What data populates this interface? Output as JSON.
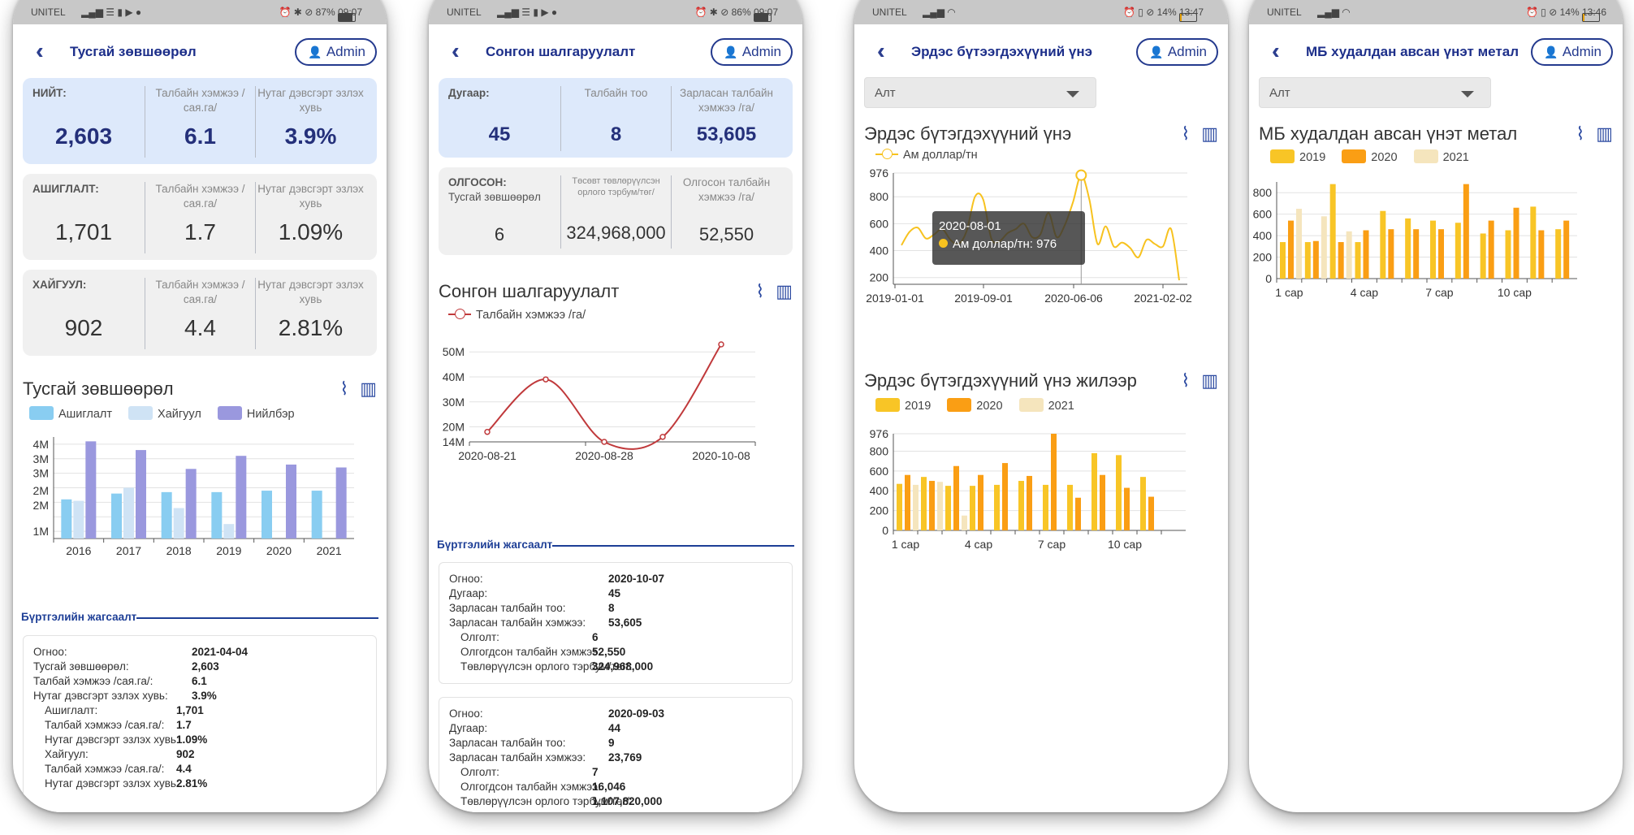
{
  "phones": [
    {
      "status": {
        "carrier": "UNITEL",
        "battery": "87%",
        "time": "09:07"
      },
      "header": {
        "title": "Тусгай зөвшөөрөл",
        "admin": "Admin"
      },
      "cards": [
        {
          "label": "НИЙТ:",
          "v1": "2,603",
          "l2": "Талбайн хэмжээ /сая.га/",
          "v2": "6.1",
          "l3": "Нутаг дэвсгэрт эзлэх хувь",
          "v3": "3.9%"
        },
        {
          "label": "АШИГЛАЛТ:",
          "v1": "1,701",
          "l2": "Талбайн хэмжээ /сая.га/",
          "v2": "1.7",
          "l3": "Нутаг дэвсгэрт эзлэх хувь",
          "v3": "1.09%"
        },
        {
          "label": "ХАЙГУУЛ:",
          "v1": "902",
          "l2": "Талбайн хэмжээ /сая.га/",
          "v2": "4.4",
          "l3": "Нутаг дэвсгэрт эзлэх хувь",
          "v3": "2.81%"
        }
      ],
      "section_title": "Тусгай зөвшөөрөл",
      "reg_title": "Бүртгэлийн жагсаалт",
      "reg": [
        {
          "rows": [
            {
              "l": "Огноо:",
              "v": "2021-04-04",
              "i": 0
            },
            {
              "l": "Тусгай зөвшөөрөл:",
              "v": "2,603",
              "i": 0
            },
            {
              "l": "Талбай хэмжээ /сая.га/:",
              "v": "6.1",
              "i": 0
            },
            {
              "l": "Нутаг дэвсгэрт эзлэх хувь:",
              "v": "3.9%",
              "i": 0
            },
            {
              "l": "Ашиглалт:",
              "v": "1,701",
              "i": 1
            },
            {
              "l": "Талбай хэмжээ /сая.га/:",
              "v": "1.7",
              "i": 1
            },
            {
              "l": "Нутаг дэвсгэрт эзлэх хувь:",
              "v": "1.09%",
              "i": 1
            },
            {
              "l": "Хайгуул:",
              "v": "902",
              "i": 1
            },
            {
              "l": "Талбай хэмжээ /сая.га/:",
              "v": "4.4",
              "i": 1
            },
            {
              "l": "Нутаг дэвсгэрт эзлэх хувь:",
              "v": "2.81%",
              "i": 1
            }
          ]
        }
      ]
    },
    {
      "status": {
        "carrier": "UNITEL",
        "battery": "86%",
        "time": "09:07"
      },
      "header": {
        "title": "Сонгон шалгаруулалт",
        "admin": "Admin"
      },
      "cards": [
        {
          "label": "Дугаар:",
          "v1": "45",
          "l2": "Талбайн тоо",
          "v2": "8",
          "l3": "Зарласан талбайн хэмжээ /га/",
          "v3": "53,605"
        },
        {
          "label": "ОЛГОСОН:",
          "sub": "Тусгай зөвшөөрөл",
          "v1": "6",
          "l2": "Төсөвт төвлөрүүлсэн орлого тэрбум/төг/",
          "v2": "324,968,000",
          "l3": "Олгосон талбайн хэмжээ /га/",
          "v3": "52,550"
        }
      ],
      "section_title": "Сонгон шалгаруулалт",
      "reg_title": "Бүртгэлийн жагсаалт",
      "reg": [
        {
          "rows": [
            {
              "l": "Огноо:",
              "v": "2020-10-07",
              "i": 0
            },
            {
              "l": "Дугаар:",
              "v": "45",
              "i": 0
            },
            {
              "l": "Зарласан талбайн тоо:",
              "v": "8",
              "i": 0
            },
            {
              "l": "Зарласан талбайн хэмжээ:",
              "v": "53,605",
              "i": 0
            },
            {
              "l": "Олголт:",
              "v": "6",
              "i": 1
            },
            {
              "l": "Олгогдсон талбайн хэмжээ:",
              "v": "52,550",
              "i": 1
            },
            {
              "l": "Төвлөрүүлсэн орлого тэрбум/төг/:",
              "v": "324,968,000",
              "i": 1
            }
          ]
        },
        {
          "rows": [
            {
              "l": "Огноо:",
              "v": "2020-09-03",
              "i": 0
            },
            {
              "l": "Дугаар:",
              "v": "44",
              "i": 0
            },
            {
              "l": "Зарласан талбайн тоо:",
              "v": "9",
              "i": 0
            },
            {
              "l": "Зарласан талбайн хэмжээ:",
              "v": "23,769",
              "i": 0
            },
            {
              "l": "Олголт:",
              "v": "7",
              "i": 1
            },
            {
              "l": "Олгогдсон талбайн хэмжээ:",
              "v": "16,046",
              "i": 1
            },
            {
              "l": "Төвлөрүүлсэн орлого тэрбум/төг/:",
              "v": "1,107,820,000",
              "i": 1
            }
          ]
        }
      ]
    },
    {
      "status": {
        "carrier": "UNITEL",
        "battery": "14%",
        "time": "13:47"
      },
      "header": {
        "title": "Эрдэс бүтээгдэхүүний үнэ",
        "admin": "Admin"
      },
      "dropdown": "Алт",
      "section_title": "Эрдэс бүтэгдэхүүний үнэ",
      "section2_title": "Эрдэс бүтэгдэхүүний үнэ жилээр",
      "tooltip": {
        "date": "2020-08-01",
        "text": "Ам доллар/тн: 976"
      }
    },
    {
      "status": {
        "carrier": "UNITEL",
        "battery": "14%",
        "time": "13:46"
      },
      "header": {
        "title": "МБ худалдан авсан үнэт метал",
        "admin": "Admin"
      },
      "dropdown": "Алт",
      "section_title": "МБ худалдан авсан үнэт метал"
    }
  ],
  "icons": {
    "back": "double-chevron-left-icon",
    "user": "user-icon",
    "line": "line-chart-icon",
    "bar": "bar-chart-icon"
  },
  "colors": {
    "accent": "#243a8e",
    "ashiglalt": "#89cdf1",
    "haiguul": "#cfe3f5",
    "niilber": "#9a98de",
    "line2": "#c0393b",
    "gold": "#f7c21f",
    "y2019": "#f8c526",
    "y2020": "#fa9e14",
    "y2021": "#f5e5bd"
  },
  "chart_data": [
    {
      "type": "bar",
      "categories": [
        "2016",
        "2017",
        "2018",
        "2019",
        "2020",
        "2021"
      ],
      "series": [
        {
          "name": "Ашиглалт",
          "values": [
            2.1,
            2.3,
            2.35,
            2.35,
            2.4,
            2.4
          ]
        },
        {
          "name": "Хайгуул",
          "values": [
            2.05,
            2.5,
            1.8,
            1.25,
            0.75,
            0.6
          ]
        },
        {
          "name": "Нийлбэр",
          "values": [
            4.1,
            3.8,
            3.15,
            3.6,
            3.3,
            3.2
          ]
        }
      ],
      "ytick_labels": [
        "1M",
        "2M",
        "2M",
        "3M",
        "3M",
        "4M"
      ],
      "ylim": [
        0.75,
        4.25
      ]
    },
    {
      "type": "line",
      "series": [
        {
          "name": "Талбайн хэмжээ /га/",
          "x": [
            "2020-08-21",
            "2020-09-03",
            "2020-09-13",
            "2020-09-24",
            "2020-10-07"
          ],
          "values": [
            18,
            39,
            14,
            16,
            53
          ]
        }
      ],
      "xtick_labels": [
        "2020-08-21",
        "2020-08-28",
        "2020-10-08"
      ],
      "ytick_labels": [
        "14M",
        "20M",
        "30M",
        "40M",
        "50M"
      ],
      "yticks": [
        14,
        20,
        30,
        40,
        50
      ],
      "ylim": [
        14,
        53
      ]
    },
    {
      "type": "line",
      "series": [
        {
          "name": "Ам доллар/тн",
          "values": [
            440,
            540,
            570,
            490,
            520,
            560,
            480,
            450,
            550,
            800,
            780,
            490,
            470,
            530,
            560,
            600,
            500,
            520,
            680,
            500,
            590,
            760,
            960,
            780,
            450,
            580,
            430,
            460,
            420,
            350,
            480,
            450,
            430,
            560,
            180
          ]
        }
      ],
      "xtick_labels": [
        "2019-01-01",
        "2019-09-01",
        "2020-06-06",
        "2021-02-02"
      ],
      "yticks": [
        200,
        400,
        600,
        800,
        976
      ],
      "ylim": [
        150,
        976
      ]
    },
    {
      "type": "bar",
      "categories": [
        "1 сар",
        "2 сар",
        "3 сар",
        "4 сар",
        "5 сар",
        "6 сар",
        "7 сар",
        "8 сар",
        "9 сар",
        "10 сар",
        "11 сар",
        "12 сар"
      ],
      "xtick_labels": [
        "1 сар",
        "4 сар",
        "7 сар",
        "10 сар"
      ],
      "series": [
        {
          "name": "2019",
          "values": [
            470,
            540,
            450,
            450,
            460,
            500,
            460,
            460,
            780,
            760,
            540,
            null
          ]
        },
        {
          "name": "2020",
          "values": [
            560,
            500,
            650,
            560,
            680,
            550,
            976,
            330,
            560,
            430,
            340,
            null
          ]
        },
        {
          "name": "2021",
          "values": [
            460,
            490,
            150,
            null,
            null,
            null,
            null,
            null,
            null,
            null,
            null,
            null
          ]
        }
      ],
      "yticks": [
        0,
        200,
        400,
        600,
        800,
        976
      ],
      "ylim": [
        0,
        976
      ]
    },
    {
      "type": "bar",
      "categories": [
        "1 сар",
        "2 сар",
        "3 сар",
        "4 сар",
        "5 сар",
        "6 сар",
        "7 сар",
        "8 сар",
        "9 сар",
        "10 сар",
        "11 сар",
        "12 сар"
      ],
      "xtick_labels": [
        "1 сар",
        "4 сар",
        "7 сар",
        "10 сар"
      ],
      "series": [
        {
          "name": "2019",
          "values": [
            340,
            340,
            880,
            340,
            630,
            560,
            540,
            520,
            420,
            450,
            670,
            460
          ]
        },
        {
          "name": "2020",
          "values": [
            540,
            350,
            340,
            450,
            460,
            460,
            460,
            880,
            540,
            660,
            450,
            540
          ]
        },
        {
          "name": "2021",
          "values": [
            650,
            580,
            440,
            null,
            null,
            null,
            null,
            null,
            null,
            null,
            null,
            null
          ]
        }
      ],
      "yticks": [
        0,
        200,
        400,
        600,
        800
      ],
      "ylim": [
        0,
        900
      ]
    }
  ]
}
